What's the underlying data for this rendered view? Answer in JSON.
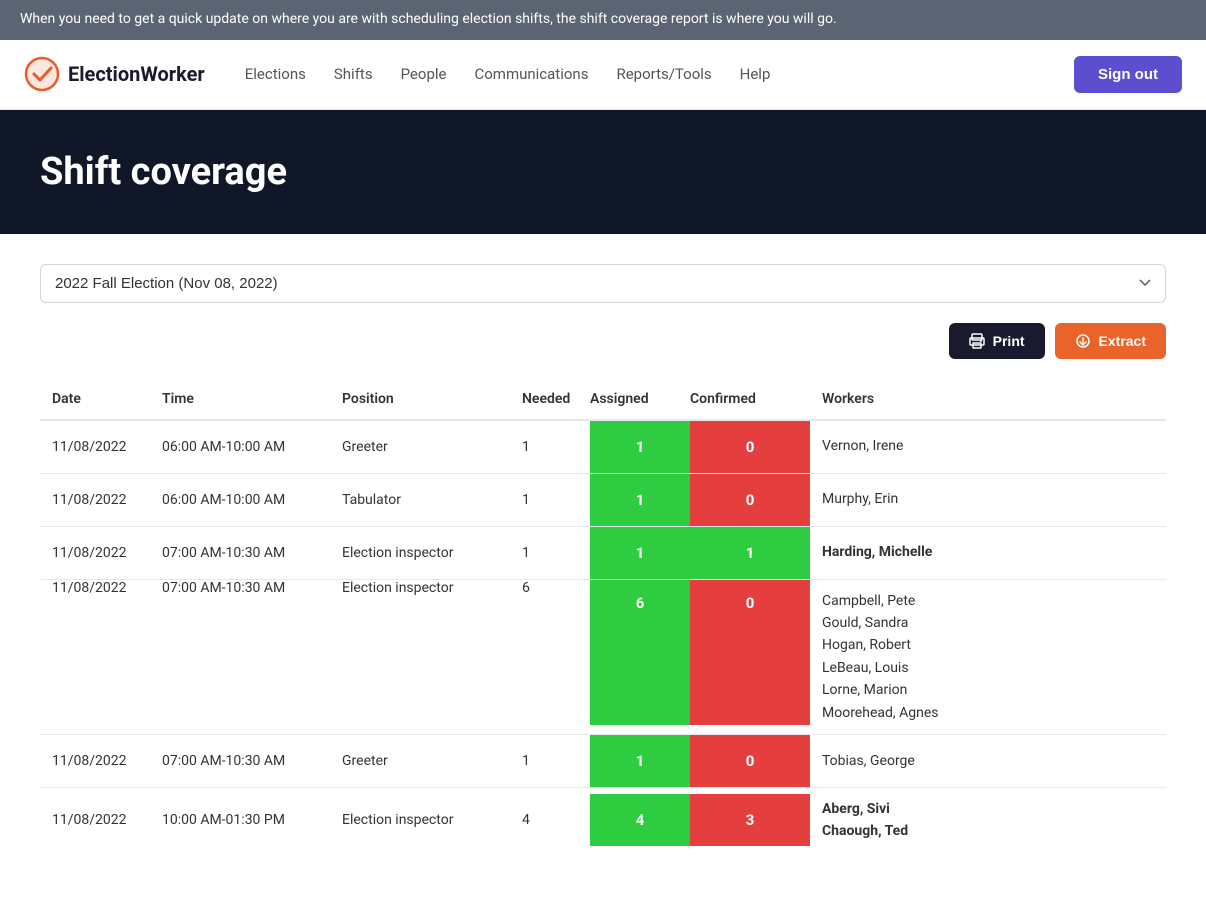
{
  "banner": {
    "text": "When you need to get a quick update on where you are with scheduling election shifts, the shift coverage report is where you will go."
  },
  "header": {
    "logo_text": "ElectionWorker",
    "nav_items": [
      {
        "label": "Elections",
        "key": "elections"
      },
      {
        "label": "Shifts",
        "key": "shifts"
      },
      {
        "label": "People",
        "key": "people"
      },
      {
        "label": "Communications",
        "key": "communications"
      },
      {
        "label": "Reports/Tools",
        "key": "reports-tools"
      },
      {
        "label": "Help",
        "key": "help"
      }
    ],
    "sign_out": "Sign out"
  },
  "page": {
    "title": "Shift coverage"
  },
  "filters": {
    "election_dropdown": "2022 Fall Election (Nov 08, 2022)"
  },
  "buttons": {
    "print": "Print",
    "extract": "Extract"
  },
  "table": {
    "headers": [
      "Date",
      "Time",
      "Position",
      "Needed",
      "Assigned",
      "Confirmed",
      "Workers"
    ],
    "rows": [
      {
        "date": "11/08/2022",
        "time": "06:00 AM-10:00 AM",
        "position": "Greeter",
        "needed": "1",
        "assigned": "1",
        "assigned_color": "green",
        "confirmed": "0",
        "confirmed_color": "red",
        "workers": [
          "Vernon, Irene"
        ],
        "workers_bold": false
      },
      {
        "date": "11/08/2022",
        "time": "06:00 AM-10:00 AM",
        "position": "Tabulator",
        "needed": "1",
        "assigned": "1",
        "assigned_color": "green",
        "confirmed": "0",
        "confirmed_color": "red",
        "workers": [
          "Murphy, Erin"
        ],
        "workers_bold": false
      },
      {
        "date": "11/08/2022",
        "time": "07:00 AM-10:30 AM",
        "position": "Election inspector",
        "needed": "1",
        "assigned": "1",
        "assigned_color": "green",
        "confirmed": "1",
        "confirmed_color": "green",
        "workers": [
          "Harding, Michelle"
        ],
        "workers_bold": true
      },
      {
        "date": "11/08/2022",
        "time": "07:00 AM-10:30 AM",
        "position": "Election inspector",
        "needed": "6",
        "assigned": "6",
        "assigned_color": "green",
        "confirmed": "0",
        "confirmed_color": "red",
        "workers": [
          "Campbell, Pete",
          "Gould, Sandra",
          "Hogan, Robert",
          "LeBeau, Louis",
          "Lorne, Marion",
          "Moorehead, Agnes"
        ],
        "workers_bold": false
      },
      {
        "date": "11/08/2022",
        "time": "07:00 AM-10:30 AM",
        "position": "Greeter",
        "needed": "1",
        "assigned": "1",
        "assigned_color": "green",
        "confirmed": "0",
        "confirmed_color": "red",
        "workers": [
          "Tobias, George"
        ],
        "workers_bold": false
      },
      {
        "date": "11/08/2022",
        "time": "10:00 AM-01:30 PM",
        "position": "Election inspector",
        "needed": "4",
        "assigned": "4",
        "assigned_color": "green",
        "confirmed": "3",
        "confirmed_color": "red",
        "workers": [
          "Aberg, Sivi",
          "Chaough, Ted"
        ],
        "workers_bold": true
      }
    ]
  }
}
